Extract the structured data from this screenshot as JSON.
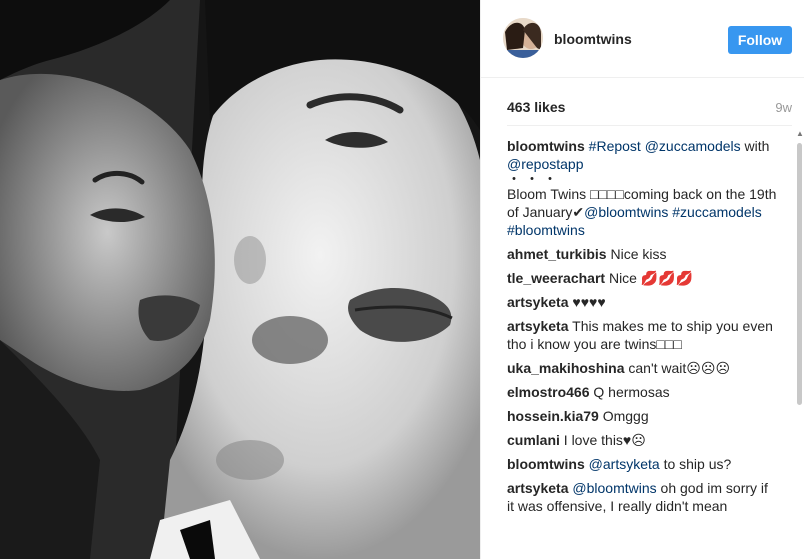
{
  "post": {
    "username": "bloomtwins",
    "follow_label": "Follow",
    "likes": "463 likes",
    "age": "9w"
  },
  "caption": {
    "user": "bloomtwins",
    "line1_tag": "#Repost",
    "line1_mention": "@zuccamodels",
    "line1_with": "with",
    "line1_app": "@repostapp",
    "dots": "・・・",
    "text": "Bloom Twins □□□□coming back on the 19th of January✔",
    "mention": "@bloomtwins",
    "tag1": "#zuccamodels",
    "tag2": "#bloomtwins"
  },
  "comments": [
    {
      "user": "ahmet_turkibis",
      "text": "Nice kiss"
    },
    {
      "user": "tle_weerachart",
      "text": "Nice 💋💋💋"
    },
    {
      "user": "artsyketa",
      "text": "♥♥♥♥"
    },
    {
      "user": "artsyketa",
      "text": "This makes me to ship you even tho i know you are twins□□□"
    },
    {
      "user": "uka_makihoshina",
      "text": "can't wait☹☹☹"
    },
    {
      "user": "elmostro466",
      "text": "Q hermosas"
    },
    {
      "user": "hossein.kia79",
      "text": "Omggg"
    },
    {
      "user": "cumlani",
      "text": "I love this♥☹"
    },
    {
      "user": "bloomtwins",
      "mention": "@artsyketa",
      "text": "to ship us?"
    },
    {
      "user": "artsyketa",
      "mention": "@bloomtwins",
      "text": "oh god im sorry if it was offensive, I really didn't mean"
    }
  ],
  "icons": {
    "scroll_up": "scroll-up-arrow-icon"
  },
  "colors": {
    "follow_button": "#3897f0",
    "link": "#003569"
  }
}
